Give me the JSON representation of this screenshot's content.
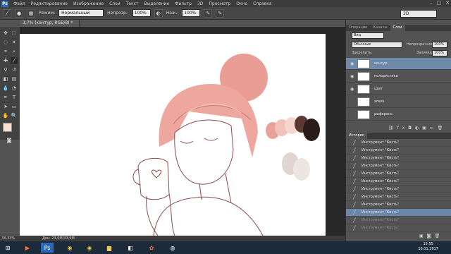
{
  "app": {
    "logo": "Ps"
  },
  "menu": [
    "Файл",
    "Редактирование",
    "Изображение",
    "Слои",
    "Текст",
    "Выделение",
    "Фильтр",
    "3D",
    "Просмотр",
    "Окно",
    "Справка"
  ],
  "window_controls": [
    "–",
    "□",
    "✕"
  ],
  "options": {
    "mode_label": "Режим:",
    "mode_value": "Нормальный",
    "opacity_label": "Непрозр.:",
    "opacity_value": "100%",
    "pressure_label": "Наж.:",
    "pressure_value": "100%",
    "workspace": "3D"
  },
  "document": {
    "tab_title": "3,7% (контур, RGB/8) *"
  },
  "status": {
    "zoom": "33,33%",
    "doc_info": "Док: 23,0М/33,9М"
  },
  "panels": {
    "top_tabs": [
      "Операции",
      "Каналы",
      "Слои"
    ],
    "kind_label": "Вид",
    "blend_mode": "Обычные",
    "opacity_label": "Непрозрачность:",
    "opacity_value": "100%",
    "lock_label": "Закрепить:",
    "fill_label": "Заливка:",
    "fill_value": "100%",
    "layers": [
      {
        "name": "контур",
        "selected": true
      },
      {
        "name": "колористика",
        "selected": false
      },
      {
        "name": "цвет",
        "selected": false
      },
      {
        "name": "эскиз",
        "selected": false
      },
      {
        "name": "референс",
        "selected": false
      }
    ],
    "history_tab": "История",
    "history": [
      {
        "label": "Инструмент \"Кисть\"",
        "state": "normal"
      },
      {
        "label": "Инструмент \"Кисть\"",
        "state": "normal"
      },
      {
        "label": "Инструмент \"Кисть\"",
        "state": "normal"
      },
      {
        "label": "Инструмент \"Кисть\"",
        "state": "normal"
      },
      {
        "label": "Инструмент \"Кисть\"",
        "state": "normal"
      },
      {
        "label": "Инструмент \"Кисть\"",
        "state": "normal"
      },
      {
        "label": "Инструмент \"Кисть\"",
        "state": "normal"
      },
      {
        "label": "Инструмент \"Кисть\"",
        "state": "normal"
      },
      {
        "label": "Инструмент \"Кисть\"",
        "state": "normal"
      },
      {
        "label": "Инструмент \"Кисть\"",
        "state": "selected"
      },
      {
        "label": "Инструмент \"Кисть\"",
        "state": "dim"
      },
      {
        "label": "Инструмент \"Кисть\"",
        "state": "dim"
      }
    ]
  },
  "swatches": [
    "#e8a29a",
    "#f2c2ba",
    "#f6d6cf",
    "#5c3a33",
    "#2a1c19",
    "#e0d6cf",
    "#ece6e0"
  ],
  "accent": "#6d8aa8",
  "taskbar": {
    "time": "15:55",
    "date": "16.01.2017"
  }
}
